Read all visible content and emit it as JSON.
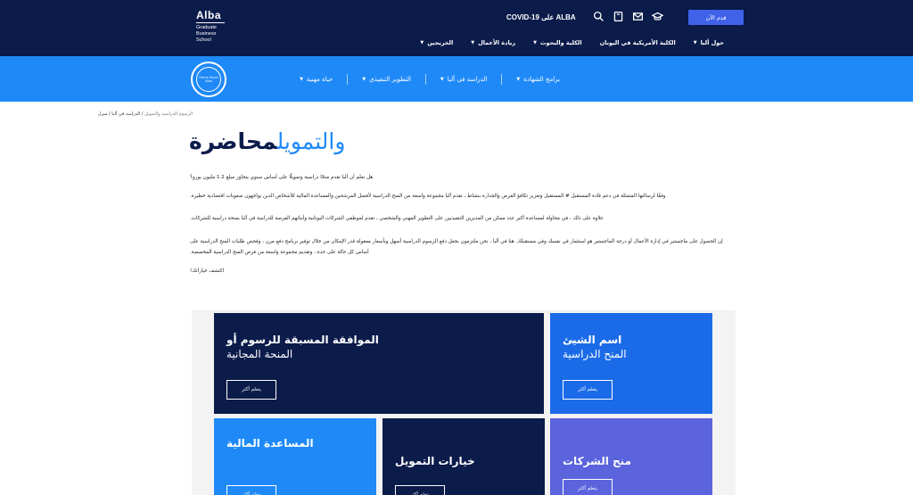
{
  "header": {
    "logo_name": "Alba",
    "logo_sub": [
      "Graduate",
      "Business",
      "School"
    ],
    "covid": "ALBA على COVID-19",
    "apply_label": "قدم الآن",
    "icons": [
      "search-icon",
      "book-icon",
      "mail-icon",
      "graduation-cap-icon"
    ],
    "nav": [
      "حول ألبا",
      "الكلية الأمريكية في اليونان",
      "الكلية والبحوث",
      "ريادة الأعمال",
      "الخريجين"
    ]
  },
  "band": {
    "seal_text": "Fierce Denis Alba",
    "subnav": [
      "برامج الشهادة",
      "الدراسة في ألبا",
      "التطوير التنفيذي",
      "حياة مهنية"
    ]
  },
  "breadcrumb": {
    "home": "منزل",
    "level1": "الدراسة في ألبا",
    "current": "الرسوم الدراسية والتمويل"
  },
  "page": {
    "title_dark": "محاضرة",
    "title_blue": "والتمويل",
    "paragraphs": [
      "هل تعلم أن ألبا تقدم منحًا دراسية وتمويلًا على أساس سنوي يتجاوز مبلغ 1.2 مليون يورو؟",
      "وفقًا لرسالتها المتمثلة في دعم قادة المستقبل # المستقبل وتعزيز تكافؤ الفرص والجدارة بنشاط ، تقدم ألبا مجموعة واسعة من المنح الدراسية لأفضل المرشحين والمساعدة المالية للأشخاص الذين يواجهون صعوبات اقتصادية خطيرة.",
      "علاوة على ذلك ، في محاولة لمساعدة أكبر عدد ممكن من المديرين التنفيذيين على التطوير المهني والشخصي ، تقدم لموظفي الشركات اليونانية وأبنائهم الفرصة للدراسة في ألبا بمنحة دراسية للشركات.",
      "إن الحصول على ماجستير في إدارة الأعمال أو درجة الماجستير هو استثمار في نفسك وفي مستقبلك. هنا في ألبا ، نحن ملتزمون بجعل دفع الرسوم الدراسية أسهل وبأسعار معقولة قدر الإمكان من خلال توفير برنامج دفع مرن ، وفحص طلبات المنح الدراسية على أساس كل حالة على حدة ، وتقديم مجموعة واسعة من فرص المنح الدراسية المخصصة.",
      "اكتشف خياراتك!"
    ]
  },
  "cards": [
    {
      "title": "الموافقة المسبقة للرسوم أو",
      "sub": "المنحة المجانية",
      "btn": "يتعلم أكثر"
    },
    {
      "title": "اسم الشيئ",
      "sub": "المنح الدراسية",
      "btn": "يتعلم أكثر"
    },
    {
      "title": "المساعدة المالية",
      "sub": "",
      "btn": "يتعلم أكثر"
    },
    {
      "title": "خيارات التمويل",
      "sub": "",
      "btn": "يتعلم أكثر"
    },
    {
      "title": "منح الشركات",
      "sub": "",
      "btn": "يتعلم أكثر"
    }
  ],
  "colors": {
    "navy": "#0b1b4a",
    "blue": "#1f8af7",
    "royal": "#1b6be8",
    "purple": "#5b63dd",
    "apply": "#3f62e8"
  }
}
